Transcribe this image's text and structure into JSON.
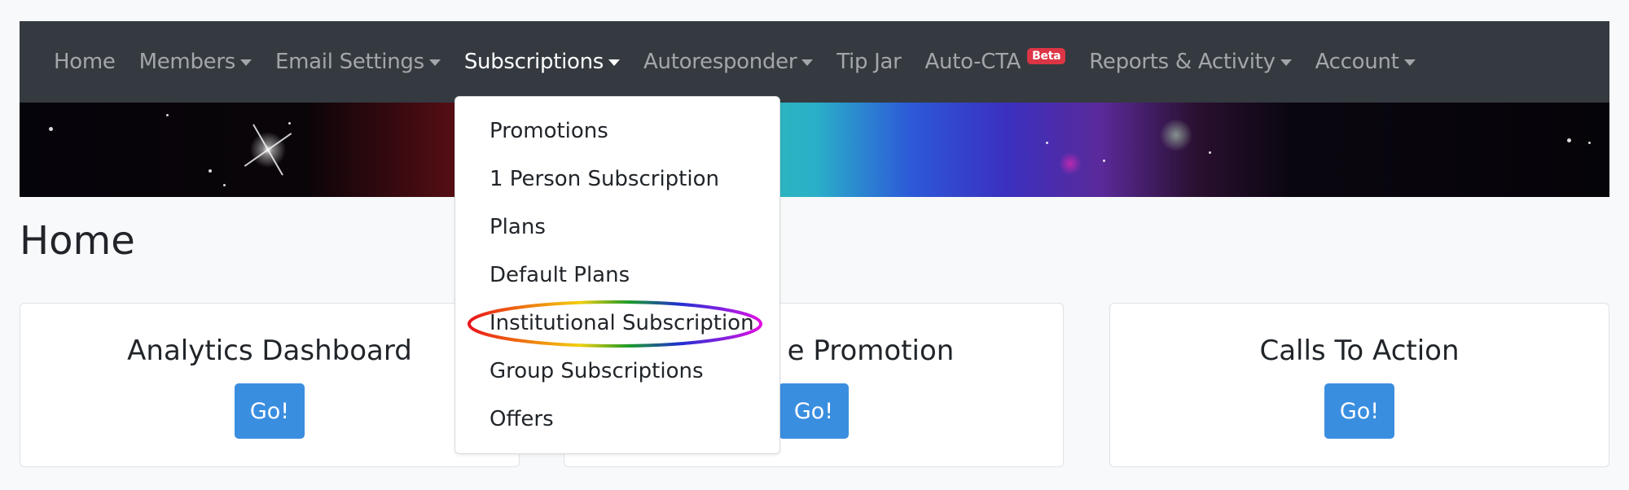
{
  "navbar": {
    "items": [
      {
        "label": "Home",
        "has_dropdown": false,
        "active": false
      },
      {
        "label": "Members",
        "has_dropdown": true,
        "active": false
      },
      {
        "label": "Email Settings",
        "has_dropdown": true,
        "active": false
      },
      {
        "label": "Subscriptions",
        "has_dropdown": true,
        "active": true
      },
      {
        "label": "Autoresponder",
        "has_dropdown": true,
        "active": false
      },
      {
        "label": "Tip Jar",
        "has_dropdown": false,
        "active": false
      },
      {
        "label": "Auto-CTA",
        "has_dropdown": false,
        "active": false,
        "badge": "Beta"
      },
      {
        "label": "Reports & Activity",
        "has_dropdown": true,
        "active": false
      },
      {
        "label": "Account",
        "has_dropdown": true,
        "active": false
      }
    ],
    "background_color": "#343a40",
    "badge_color": "#dc3545"
  },
  "subscriptions_dropdown": {
    "items": [
      {
        "label": "Promotions"
      },
      {
        "label": "1 Person Subscription"
      },
      {
        "label": "Plans"
      },
      {
        "label": "Default Plans"
      },
      {
        "label": "Institutional Subscription",
        "highlighted": true
      },
      {
        "label": "Group Subscriptions"
      },
      {
        "label": "Offers"
      }
    ]
  },
  "page": {
    "title": "Home"
  },
  "cards": [
    {
      "title": "Analytics Dashboard",
      "button_label": "Go!"
    },
    {
      "title": "e Promotion",
      "button_label": "Go!"
    },
    {
      "title": "Calls To Action",
      "button_label": "Go!"
    }
  ],
  "colors": {
    "primary_button": "#3a8ee0",
    "page_background": "#f8f9fa"
  }
}
